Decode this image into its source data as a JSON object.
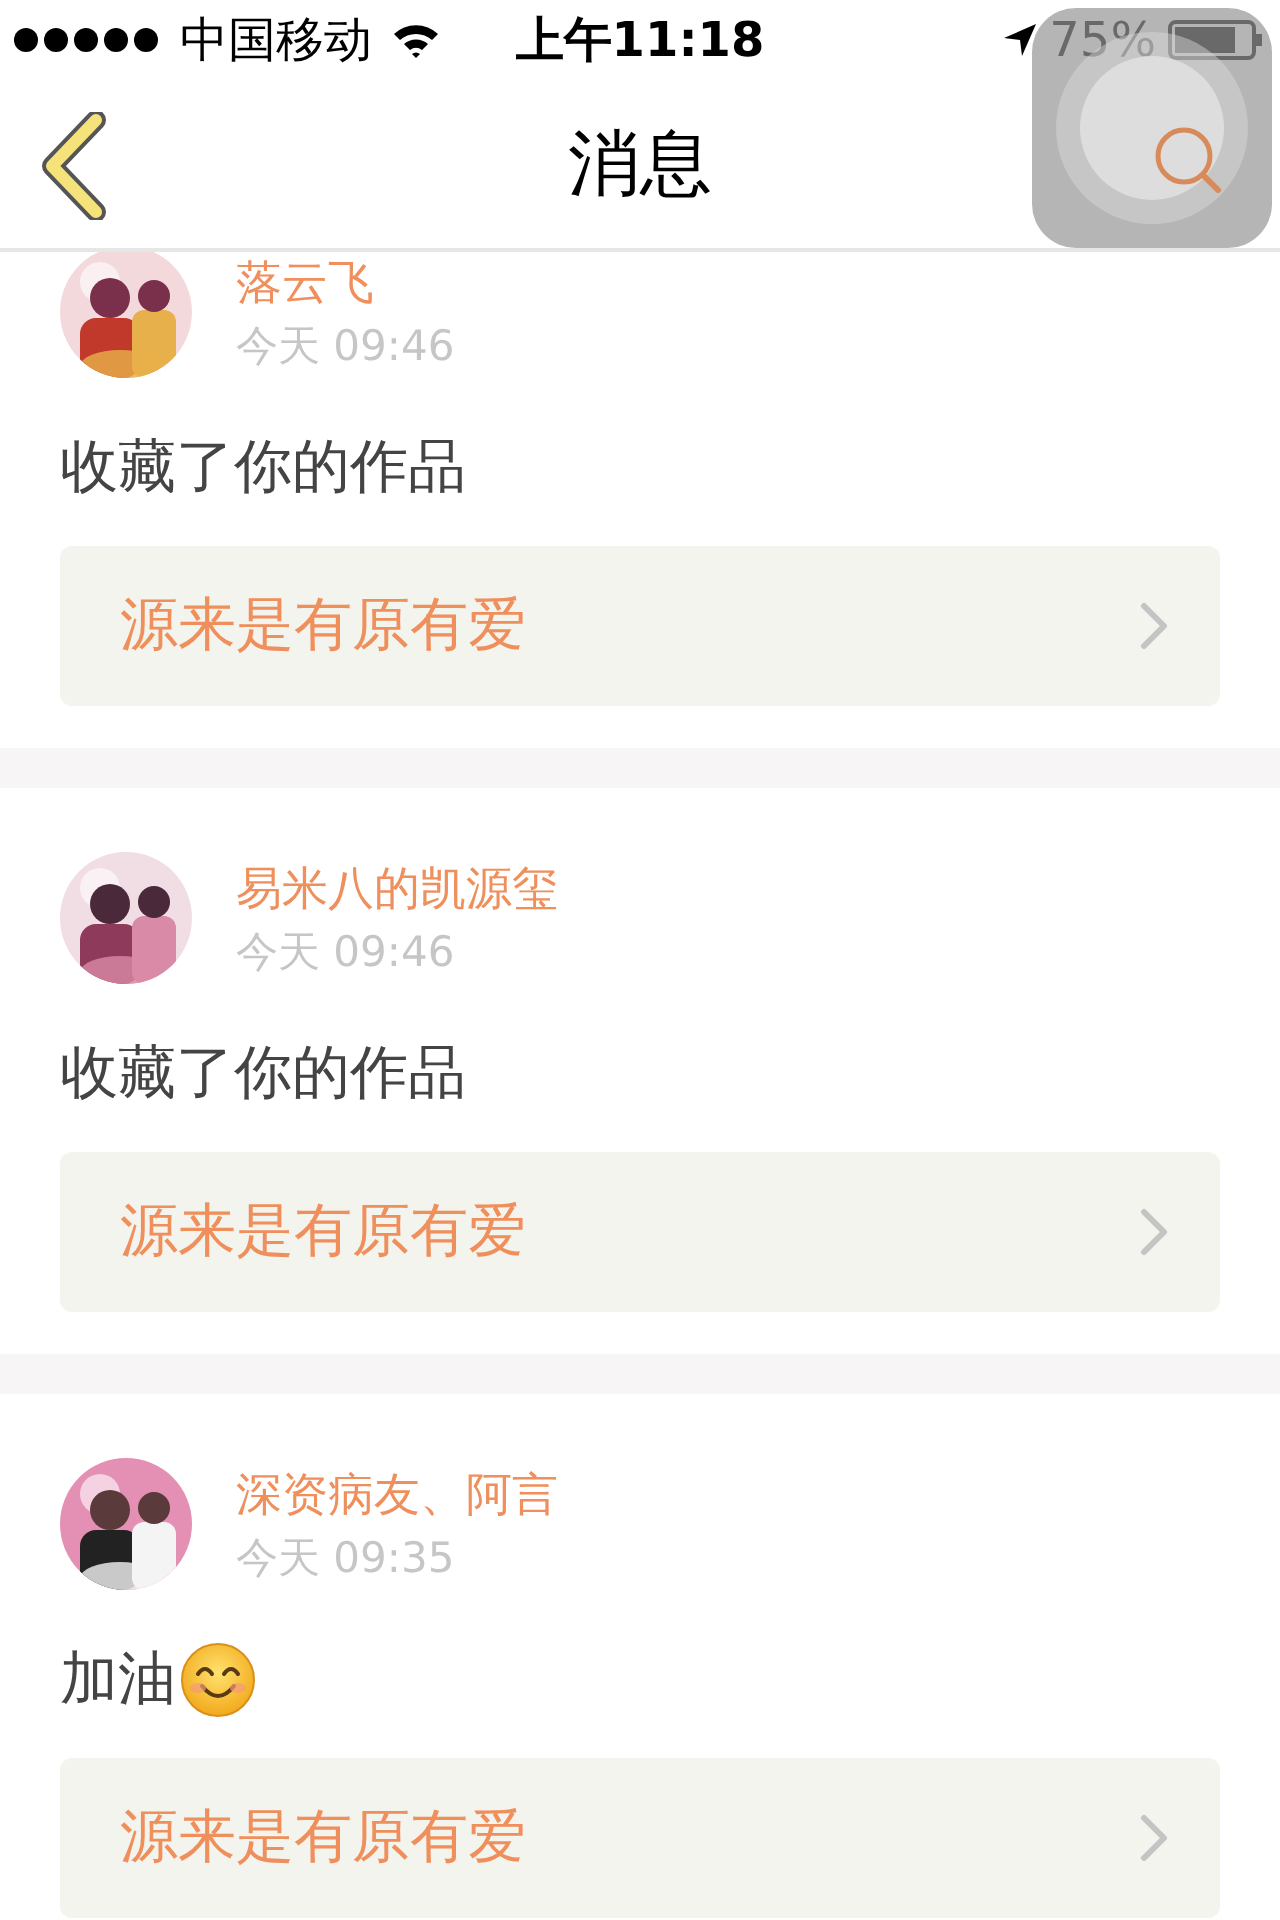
{
  "status_bar": {
    "carrier": "中国移动",
    "time": "上午11:18",
    "battery": "75%"
  },
  "nav": {
    "title": "消息"
  },
  "messages": [
    {
      "name": "落云飞",
      "time": "今天 09:46",
      "text": "收藏了你的作品",
      "trailing_emoji": false,
      "work": "源来是有原有爱"
    },
    {
      "name": "易米八的凯源玺",
      "time": "今天 09:46",
      "text": "收藏了你的作品",
      "trailing_emoji": false,
      "work": "源来是有原有爱"
    },
    {
      "name": "深资病友、阿言",
      "time": "今天 09:35",
      "text": "加油",
      "trailing_emoji": true,
      "work": "源来是有原有爱"
    }
  ]
}
